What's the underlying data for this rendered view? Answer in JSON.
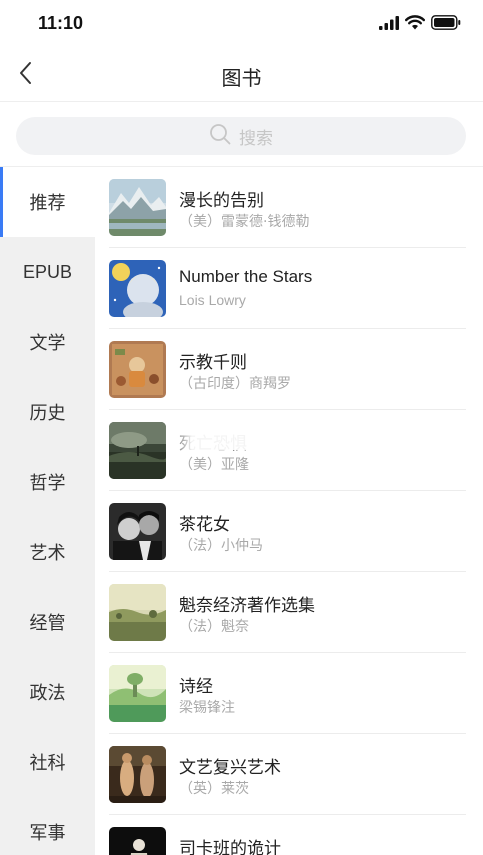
{
  "status_bar": {
    "time": "11:10"
  },
  "nav": {
    "title": "图书"
  },
  "search": {
    "placeholder": "搜索"
  },
  "sidebar": {
    "items": [
      {
        "label": "推荐",
        "active": true
      },
      {
        "label": "EPUB"
      },
      {
        "label": "文学"
      },
      {
        "label": "历史"
      },
      {
        "label": "哲学"
      },
      {
        "label": "艺术"
      },
      {
        "label": "经管"
      },
      {
        "label": "政法"
      },
      {
        "label": "社科"
      },
      {
        "label": "军事"
      }
    ]
  },
  "books": [
    {
      "title": "漫长的告别",
      "author": "（美）雷蒙德·钱德勒",
      "cover": "mountain-lake-painting"
    },
    {
      "title": "Number the Stars",
      "author": "Lois Lowry",
      "cover": "girl-portrait-blue"
    },
    {
      "title": "示教千则",
      "author": "（古印度）商羯罗",
      "cover": "indian-miniature-painting"
    },
    {
      "title": "死亡恐惧",
      "author": "（美）亚隆",
      "cover": "dark-landscape-painting"
    },
    {
      "title": "茶花女",
      "author": "（法）小仲马",
      "cover": "film-still-couple"
    },
    {
      "title": "魁奈经济著作选集",
      "author": "（法）魁奈",
      "cover": "rural-landscape-painting"
    },
    {
      "title": "诗经",
      "author": "梁锡锋注",
      "cover": "green-landscape-painting"
    },
    {
      "title": "文艺复兴艺术",
      "author": "（英）莱茨",
      "cover": "renaissance-figures-painting"
    },
    {
      "title": "司卡班的诡计",
      "author": "",
      "cover": "dark-stage-figure"
    }
  ],
  "colors": {
    "accent": "#3a7bf5",
    "sidebar_bg": "#f0f0f0",
    "secondary_text": "#a9a9a9"
  }
}
